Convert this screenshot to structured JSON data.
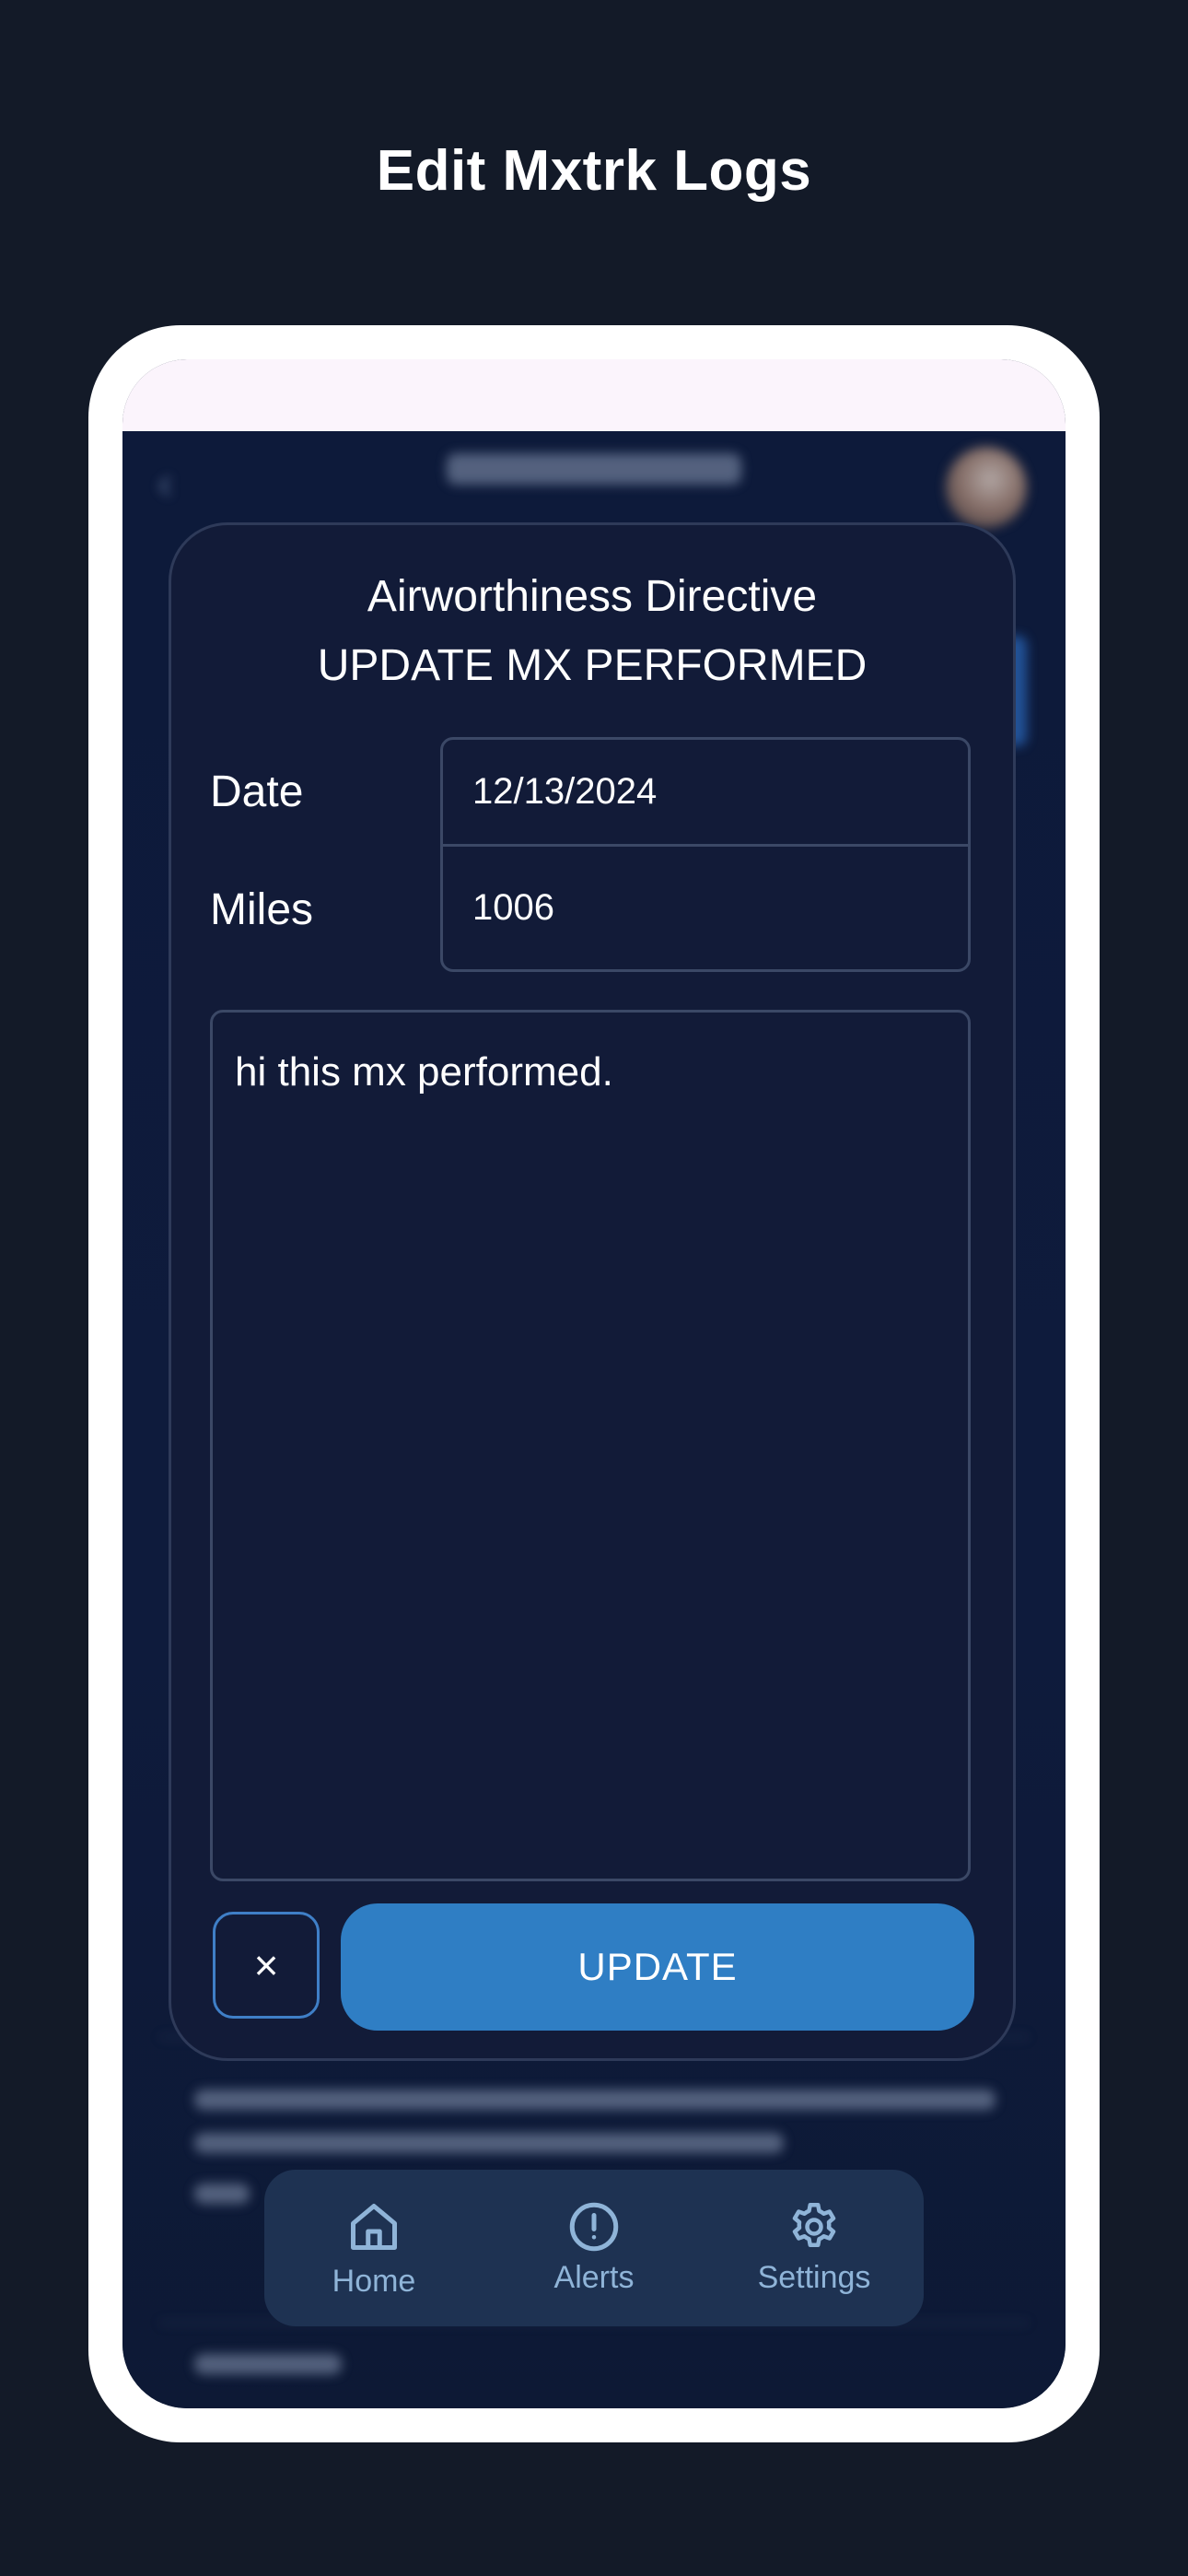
{
  "page": {
    "title": "Edit Mxtrk Logs"
  },
  "modal": {
    "title_line1": "Airworthiness Directive",
    "title_line2": "UPDATE MX PERFORMED",
    "date_label": "Date",
    "date_value": "12/13/2024",
    "miles_label": "Miles",
    "miles_value": "1006",
    "notes_value": "hi this mx performed.",
    "close_symbol": "×",
    "update_label": "UPDATE"
  },
  "bottom_nav": {
    "items": [
      {
        "label": "Home",
        "icon": "home-icon"
      },
      {
        "label": "Alerts",
        "icon": "alert-icon"
      },
      {
        "label": "Settings",
        "icon": "gear-icon"
      }
    ]
  },
  "colors": {
    "page_background": "#131a28",
    "modal_background": "#121b38",
    "accent": "#2f7ec4",
    "nav_background": "#1e3252",
    "nav_text": "#8fb4d8"
  }
}
